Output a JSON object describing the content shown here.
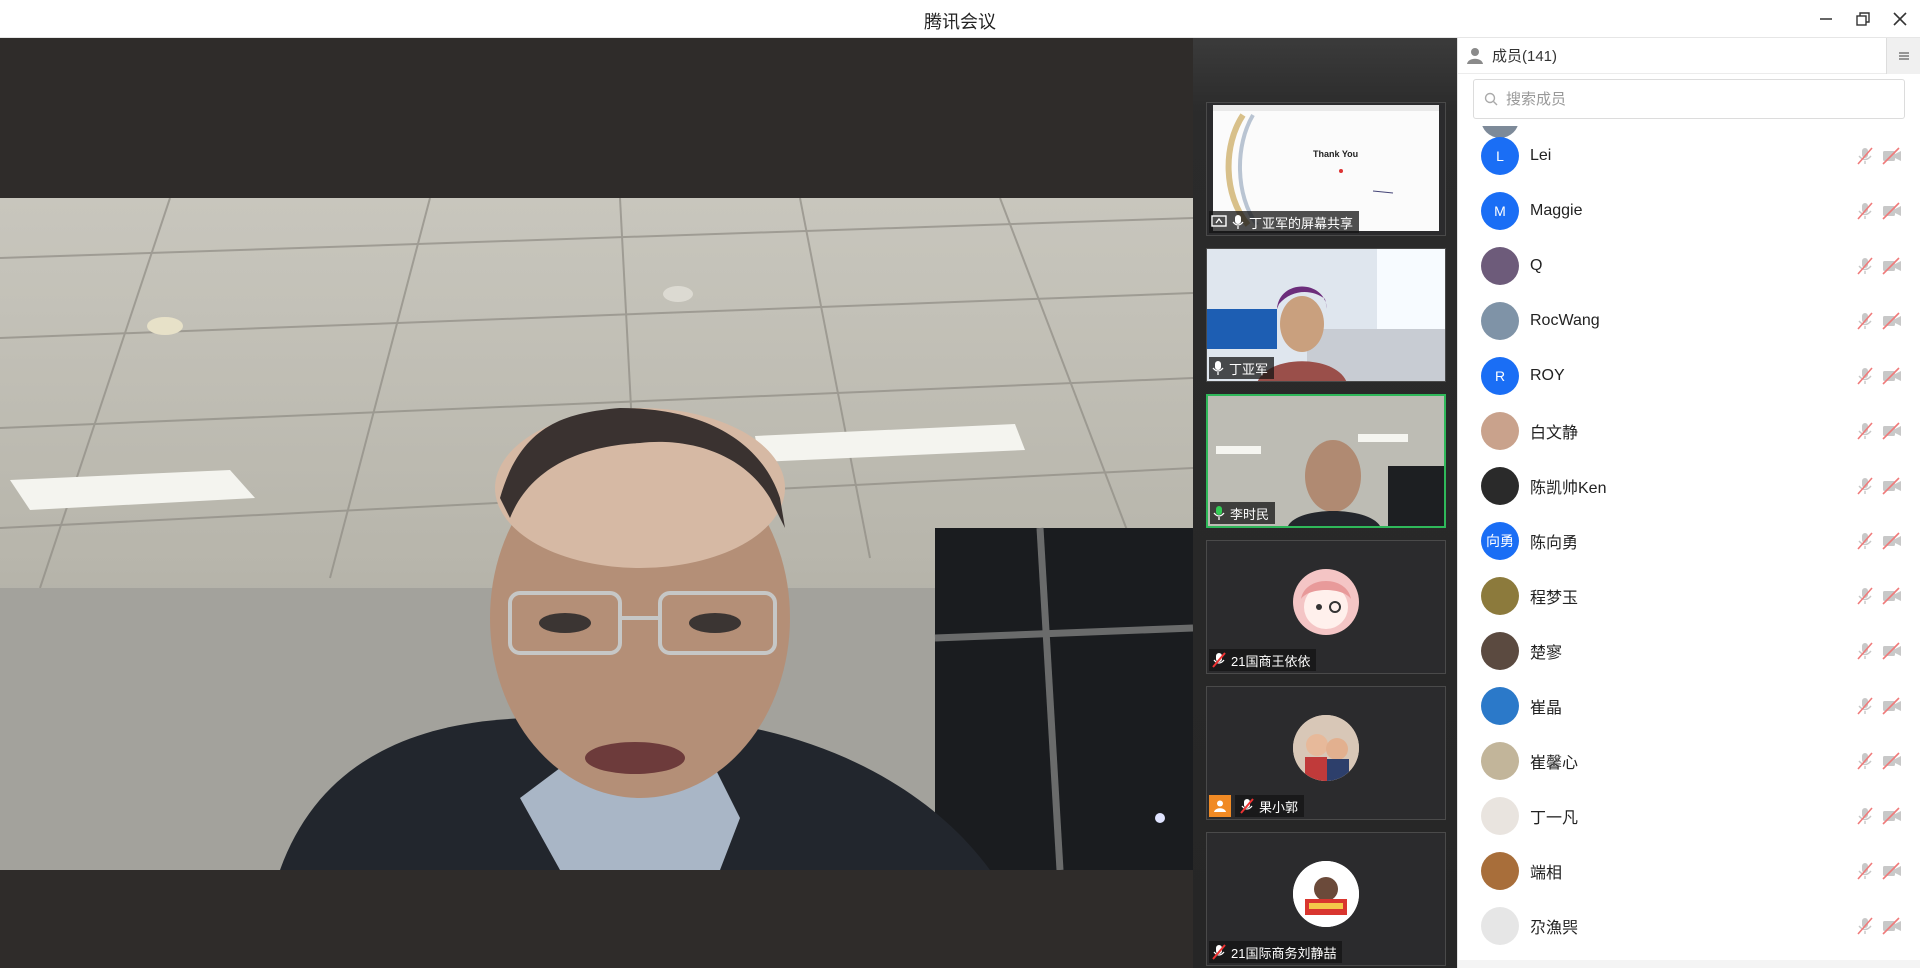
{
  "window": {
    "title": "腾讯会议"
  },
  "filmstrip": {
    "tiles": [
      {
        "label": "丁亚军的屏幕共享",
        "slide_text": "Thank You"
      },
      {
        "label": "丁亚军"
      },
      {
        "label": "李时民"
      },
      {
        "label": "21国商王依依"
      },
      {
        "label": "果小郭"
      },
      {
        "label": "21国际商务刘静喆"
      }
    ]
  },
  "panel": {
    "header": "成员(141)",
    "search_placeholder": "搜索成员",
    "members": [
      {
        "name": "Lei",
        "initial": "L",
        "avatar_color": "#1a6ef5"
      },
      {
        "name": "Maggie",
        "initial": "M",
        "avatar_color": "#1a6ef5"
      },
      {
        "name": "Q",
        "initial": "",
        "avatar_color": "#6d5b7a"
      },
      {
        "name": "RocWang",
        "initial": "",
        "avatar_color": "#7f93a7"
      },
      {
        "name": "ROY",
        "initial": "R",
        "avatar_color": "#1a6ef5"
      },
      {
        "name": "白文静",
        "initial": "",
        "avatar_color": "#c9a28c"
      },
      {
        "name": "陈凯帅Ken",
        "initial": "",
        "avatar_color": "#2a2a2a"
      },
      {
        "name": "陈向勇",
        "initial": "向勇",
        "avatar_color": "#1a6ef5"
      },
      {
        "name": "程梦玉",
        "initial": "",
        "avatar_color": "#8c7a3c"
      },
      {
        "name": "楚寥",
        "initial": "",
        "avatar_color": "#5b4a40"
      },
      {
        "name": "崔晶",
        "initial": "",
        "avatar_color": "#2b79c9"
      },
      {
        "name": "崔馨心",
        "initial": "",
        "avatar_color": "#c2b59a"
      },
      {
        "name": "丁一凡",
        "initial": "",
        "avatar_color": "#e9e4df"
      },
      {
        "name": "端相",
        "initial": "",
        "avatar_color": "#a86e3a"
      },
      {
        "name": "尕漁巺",
        "initial": "",
        "avatar_color": "#e6e6e6"
      }
    ]
  }
}
